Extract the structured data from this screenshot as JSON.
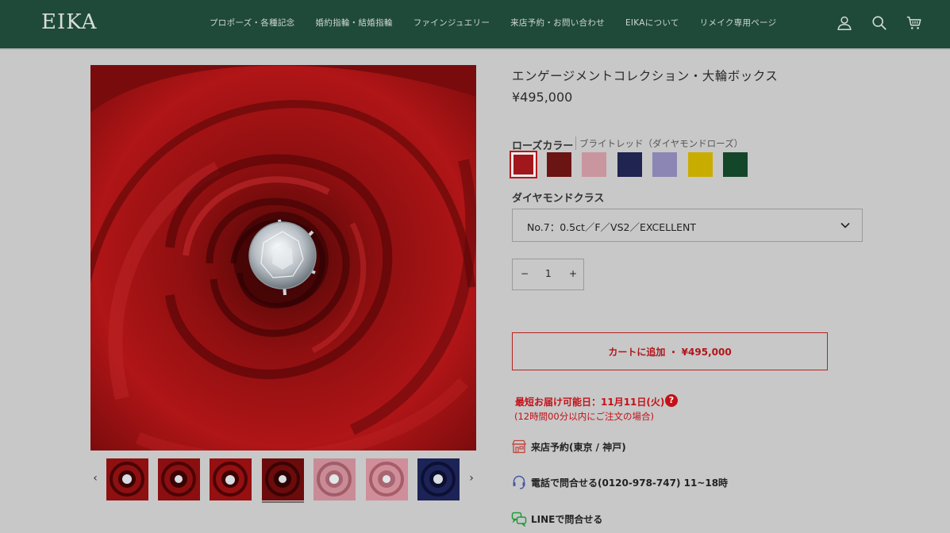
{
  "header": {
    "logo": "EIKA",
    "nav": [
      "プロポーズ・各種記念",
      "婚約指輪・結婚指輪",
      "ファインジュエリー",
      "来店予約・お問い合わせ",
      "EIKAについて",
      "リメイク専用ページ"
    ],
    "icons": [
      "account-icon",
      "search-icon",
      "cart-icon"
    ]
  },
  "product": {
    "title": "エンゲージメントコレクション・大輪ボックス",
    "price": "¥495,000"
  },
  "rose_color": {
    "label": "ローズカラー",
    "selected_value": "ブライトレッド（ダイヤモンドローズ）",
    "swatches": [
      {
        "name": "bright-red",
        "color": "#a1171b",
        "selected": true
      },
      {
        "name": "dark-red",
        "color": "#6b1414"
      },
      {
        "name": "pink",
        "color": "#c9969f"
      },
      {
        "name": "navy",
        "color": "#1f2451"
      },
      {
        "name": "lavender",
        "color": "#8b86b4"
      },
      {
        "name": "yellow",
        "color": "#c9ac00"
      },
      {
        "name": "green",
        "color": "#14472a"
      }
    ]
  },
  "diamond_class": {
    "label": "ダイヤモンドクラス",
    "selected": "No.7：0.5ct／F／VS2／EXCELLENT"
  },
  "quantity": {
    "minus": "−",
    "value": "1",
    "plus": "+"
  },
  "cart": {
    "label": "カートに追加 ・ ¥495,000"
  },
  "delivery": {
    "text": "最短お届け可能日：11月11日(火)",
    "help": "?",
    "note": "(12時間00分以内にご注文の場合)"
  },
  "info_links": [
    {
      "icon": "store-icon",
      "text": "来店予約(東京 / 神戸)"
    },
    {
      "icon": "headset-icon",
      "text": "電話で問合せる(0120-978-747) 11~18時"
    },
    {
      "icon": "line-chat-icon",
      "text": "LINEで問合せる"
    }
  ],
  "gallery": {
    "prev": "‹",
    "next": "›",
    "thumbnails": [
      "red",
      "red",
      "red",
      "red",
      "pink",
      "pink",
      "navy"
    ],
    "active_index": 3
  },
  "colors": {
    "header_bg": "#1f4a3a",
    "page_bg": "#c8c8c8",
    "accent_red": "#c41017"
  }
}
